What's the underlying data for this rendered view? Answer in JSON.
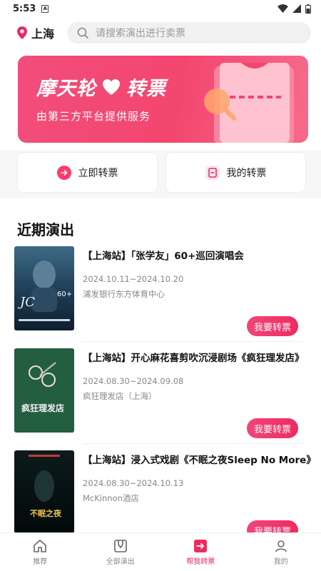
{
  "status": {
    "time": "5:53",
    "sim_label": "A"
  },
  "header": {
    "city": "上海",
    "search_placeholder": "请搜索演出进行卖票"
  },
  "banner": {
    "brand": "摩天轮",
    "title": "转票",
    "subtitle": "由第三方平台提供服务"
  },
  "quick_actions": {
    "transfer_now": "立即转票",
    "my_transfers": "我的转票"
  },
  "section_title": "近期演出",
  "shows": [
    {
      "name": "【上海站】「张学友」60+巡回演唱会",
      "date": "2024.10.11~2024.10.20",
      "venue": "浦发银行东方体育中心",
      "button": "我要转票",
      "poster_text": "JACKY CHEUNG 60+ CONCERT TOUR"
    },
    {
      "name": "【上海站】开心麻花喜剪吹沉浸剧场《疯狂理发店》",
      "date": "2024.08.30~2024.09.08",
      "venue": "疯狂理发店（上海）",
      "button": "我要转票",
      "poster_text": "疯狂理发店"
    },
    {
      "name": "【上海站】浸入式戏剧《不眠之夜Sleep No More》",
      "date": "2024.08.30~2024.10.13",
      "venue": "McKinnon酒店",
      "button": "我要转票",
      "poster_text": "不眠之夜"
    }
  ],
  "tabs": [
    {
      "label": "推荐",
      "icon": "home-icon"
    },
    {
      "label": "全部演出",
      "icon": "shows-icon"
    },
    {
      "label": "帮我转票",
      "icon": "transfer-icon",
      "active": true
    },
    {
      "label": "我的",
      "icon": "user-icon"
    }
  ],
  "colors": {
    "accent": "#ee2b5e",
    "banner": "#f3466f"
  }
}
